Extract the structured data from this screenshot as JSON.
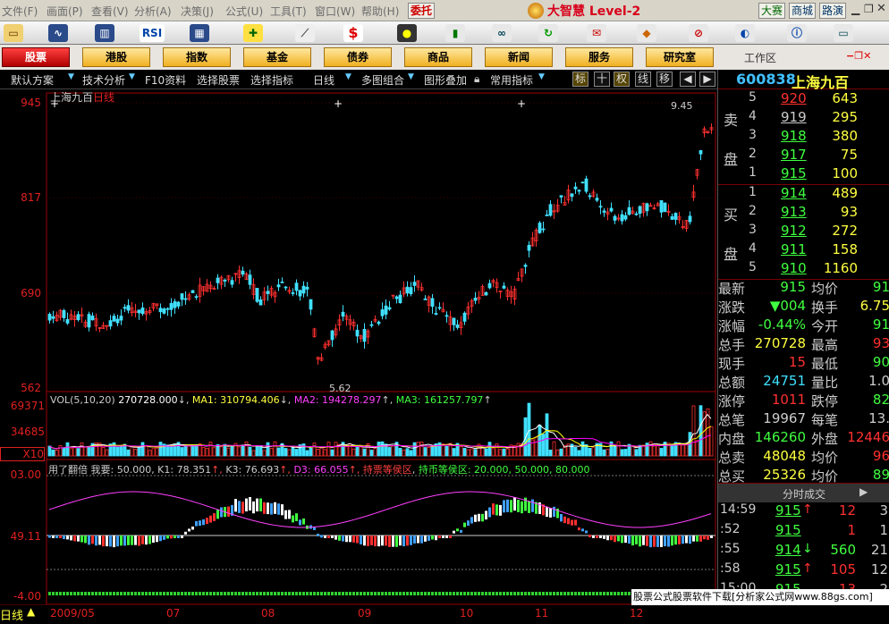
{
  "menu": {
    "items": [
      "文件(F)",
      "画面(P)",
      "查看(V)",
      "分析(A)",
      "决策(J)",
      "公式(U)",
      "工具(T)",
      "窗口(W)",
      "帮助(H)"
    ],
    "entrust_label": "委托",
    "app_title": "大智慧 Level-2",
    "right_buttons": [
      "大赛",
      "商城",
      "路演"
    ]
  },
  "categories": {
    "items": [
      "股票",
      "港股",
      "指数",
      "基金",
      "债券",
      "商品",
      "新闻",
      "服务",
      "研究室"
    ],
    "active_index": 0,
    "workspace_label": "工作区"
  },
  "funcbar": {
    "items": [
      "默认方案",
      "技术分析",
      "F10资料",
      "选择股票",
      "选择指标",
      "日线",
      "多图组合",
      "图形叠加",
      "常用指标"
    ],
    "toggles": [
      "标",
      "十",
      "权",
      "线",
      "移"
    ]
  },
  "chart": {
    "stock_name": "上海九百",
    "period": "日线",
    "price_ticks": [
      "945",
      "817",
      "690",
      "562"
    ],
    "high_label": "9.45",
    "low_label": "5.62",
    "vol_title": "VOL(5,10,20)",
    "vol_value": "270728.000",
    "ma_labels": [
      "MA1: 310794.406",
      "MA2: 194278.297",
      "MA3: 161257.797"
    ],
    "vol_ticks": [
      "69371",
      "34685",
      "X10"
    ],
    "ind_title": "用了翻倍",
    "ind_text": "我要: 50.000, K1: 78.351",
    "ind_k3": "K3: 76.693",
    "ind_d3": "D3: 66.055",
    "ind_zones": "持票等侯区",
    "ind_zones2": "持币等侯区: 20.000, 50.000, 80.000",
    "ind_ticks": [
      "03.00",
      "49.11",
      "-4.00"
    ],
    "months": [
      "2009/05",
      "07",
      "08",
      "09",
      "10",
      "11",
      "12"
    ],
    "footer_label": "日线"
  },
  "quote": {
    "code": "600838",
    "name": "上海九百",
    "sell_label": [
      "卖",
      "盘"
    ],
    "buy_label": [
      "买",
      "盘"
    ],
    "sells": [
      {
        "lv": "5",
        "price": "920",
        "vol": "643"
      },
      {
        "lv": "4",
        "price": "919",
        "vol": "295"
      },
      {
        "lv": "3",
        "price": "918",
        "vol": "380"
      },
      {
        "lv": "2",
        "price": "917",
        "vol": "75"
      },
      {
        "lv": "1",
        "price": "915",
        "vol": "100"
      }
    ],
    "buys": [
      {
        "lv": "1",
        "price": "914",
        "vol": "489"
      },
      {
        "lv": "2",
        "price": "913",
        "vol": "93"
      },
      {
        "lv": "3",
        "price": "912",
        "vol": "272"
      },
      {
        "lv": "4",
        "price": "911",
        "vol": "158"
      },
      {
        "lv": "5",
        "price": "910",
        "vol": "1160"
      }
    ],
    "stats": [
      {
        "k1": "最新",
        "v1": "915",
        "k2": "均价",
        "v2": "91"
      },
      {
        "k1": "涨跌",
        "v1": "▼004",
        "k2": "换手",
        "v2": "6.75"
      },
      {
        "k1": "涨幅",
        "v1": "-0.44%",
        "k2": "今开",
        "v2": "91"
      },
      {
        "k1": "总手",
        "v1": "270728",
        "k2": "最高",
        "v2": "93"
      },
      {
        "k1": "现手",
        "v1": "15",
        "k2": "最低",
        "v2": "90"
      },
      {
        "k1": "总额",
        "v1": "24751",
        "k2": "量比",
        "v2": "1.0"
      },
      {
        "k1": "涨停",
        "v1": "1011",
        "k2": "跌停",
        "v2": "82"
      },
      {
        "k1": "总笔",
        "v1": "19967",
        "k2": "每笔",
        "v2": "13."
      },
      {
        "k1": "内盘",
        "v1": "146260",
        "k2": "外盘",
        "v2": "12446"
      },
      {
        "k1": "总卖",
        "v1": "48048",
        "k2": "均价",
        "v2": "96"
      },
      {
        "k1": "总买",
        "v1": "25326",
        "k2": "均价",
        "v2": "89"
      }
    ],
    "ticks_title": "分时成交",
    "ticks": [
      {
        "t": "14:59",
        "p": "915",
        "arrow": "↑",
        "v": "12",
        "n": "3"
      },
      {
        "t": ":52",
        "p": "915",
        "arrow": "",
        "v": "1",
        "n": "1"
      },
      {
        "t": ":55",
        "p": "914",
        "arrow": "↓",
        "v": "560",
        "n": "21"
      },
      {
        "t": ":58",
        "p": "915",
        "arrow": "↑",
        "v": "105",
        "n": "12"
      },
      {
        "t": "15:00",
        "p": "915",
        "arrow": "",
        "v": "13",
        "n": "2"
      }
    ]
  },
  "watermark": "股票公式股票软件下载[分析家公式网www.88gs.com]",
  "colors": {
    "up": "#ff3030",
    "down": "#40e0ff",
    "accent": "#ffff40"
  }
}
